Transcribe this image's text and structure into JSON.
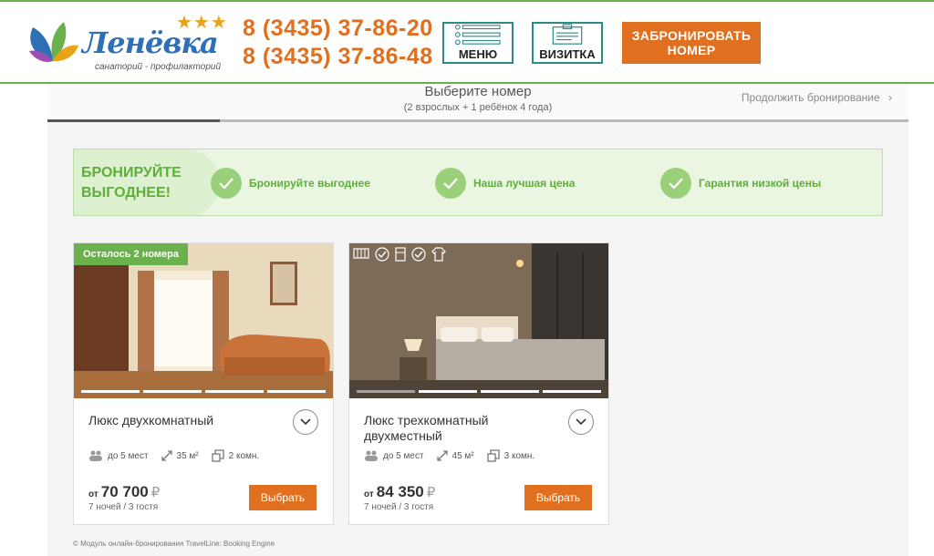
{
  "header": {
    "logo_name": "Ленёвка",
    "logo_subtitle": "санаторий - профилакторий",
    "stars": "★★★",
    "phones": [
      "8 (3435) 37-86-20",
      "8 (3435) 37-86-48"
    ],
    "menu_label": "МЕНЮ",
    "card_label": "ВИЗИТКА",
    "book_label_line1": "ЗАБРОНИРОВАТЬ",
    "book_label_line2": "НОМЕР"
  },
  "booking": {
    "step_title": "Выберите номер",
    "step_subtitle": "(2 взрослых + 1 ребёнок 4 года)",
    "continue_label": "Продолжить бронирование",
    "progress": 0.2
  },
  "promo": {
    "title_line1": "БРОНИРУЙТЕ",
    "title_line2": "ВЫГОДНЕЕ!",
    "items": [
      {
        "label": "Бронируйте выгоднее"
      },
      {
        "label": "Наша лучшая цена"
      },
      {
        "label": "Гарантия низкой цены"
      }
    ]
  },
  "rooms": [
    {
      "badge": "Осталось 2 номера",
      "name": "Люкс двухкомнатный",
      "guests": "до 5 мест",
      "area": "35 м²",
      "rooms": "2 комн.",
      "price_from": "от",
      "price": "70 700",
      "currency": "₽",
      "nights": "7 ночей / 3 гостя",
      "select_label": "Выбрать"
    },
    {
      "badge": "",
      "name": "Люкс трехкомнатный двухместный",
      "guests": "до 5 мест",
      "area": "45 м²",
      "rooms": "3 комн.",
      "price_from": "от",
      "price": "84 350",
      "currency": "₽",
      "nights": "7 ночей / 3 гостя",
      "select_label": "Выбрать"
    }
  ],
  "footer": {
    "note": "© Модуль онлайн-бронирования TravelLine: Booking Engine"
  },
  "colors": {
    "accent_orange": "#e06f1f",
    "accent_green": "#6ab04c",
    "teal_border": "#2b8a8a"
  }
}
